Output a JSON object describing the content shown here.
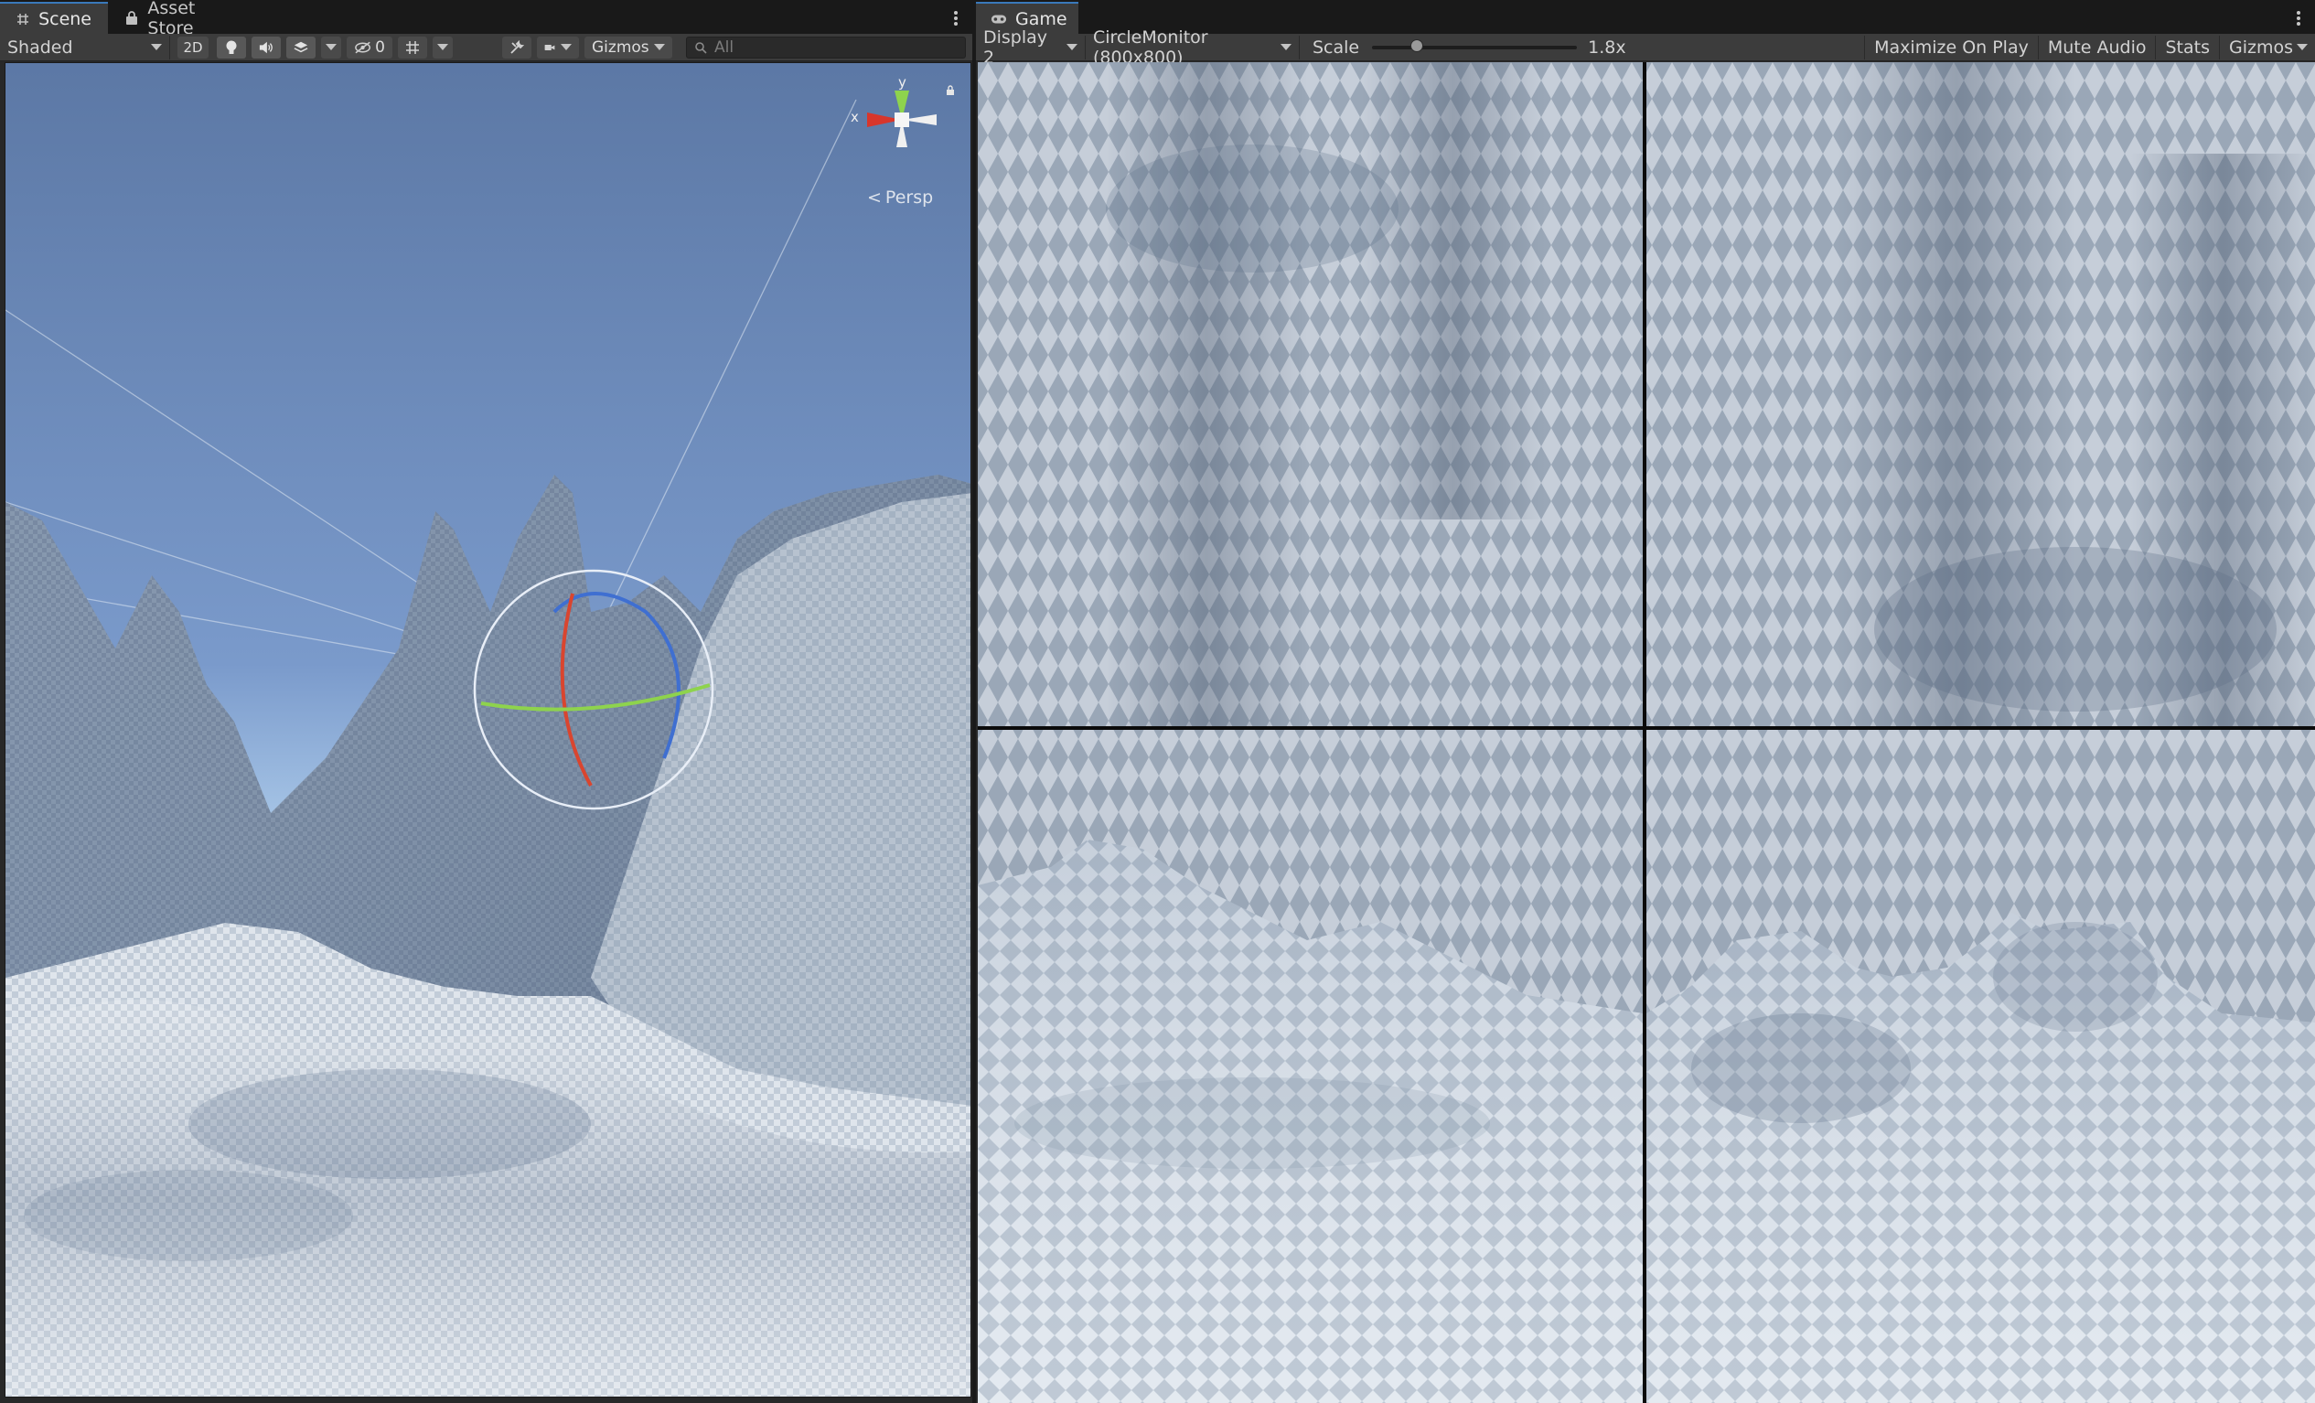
{
  "scene_tab": {
    "tabs": [
      {
        "label": "Scene",
        "icon": "grid-icon"
      },
      {
        "label": "Asset Store",
        "icon": "lock-bag-icon"
      }
    ],
    "toolbar": {
      "draw_mode": "Shaded",
      "mode_2d": "2D",
      "hidden_count": "0",
      "gizmos": "Gizmos",
      "search_placeholder": "All"
    },
    "orientation_gizmo": {
      "y_label": "y",
      "x_label": "x",
      "projection": "Persp",
      "colors": {
        "x": "#d8362b",
        "y": "#8ed34d",
        "z": "#f0f0f0"
      }
    }
  },
  "game_tab": {
    "tab": {
      "label": "Game",
      "icon": "gamepad-icon"
    },
    "toolbar": {
      "display": "Display 2",
      "resolution": "CircleMonitor (800x800)",
      "scale_label": "Scale",
      "scale_value": "1.8x",
      "scale_fraction": 0.2,
      "maximize": "Maximize On Play",
      "mute": "Mute Audio",
      "stats": "Stats",
      "gizmos": "Gizmos"
    }
  },
  "colors": {
    "sky_top": "#5b79a8",
    "sky_horizon": "#a9cdf0",
    "terrain_light": "#e8ecf1",
    "terrain_shadow": "#7d8ea3",
    "accent_blue": "#3a79bb"
  }
}
